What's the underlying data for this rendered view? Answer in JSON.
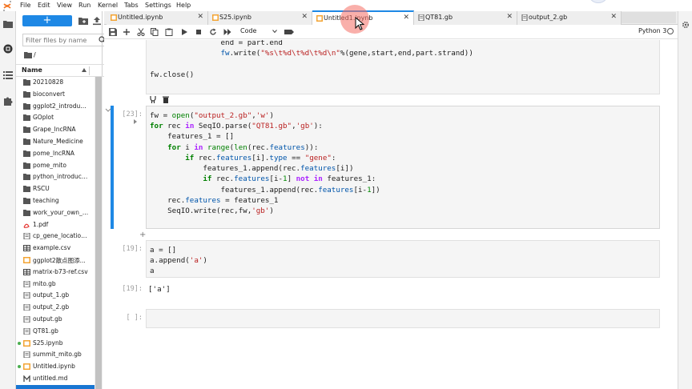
{
  "menubar": {
    "items": [
      "File",
      "Edit",
      "View",
      "Run",
      "Kernel",
      "Tabs",
      "Settings",
      "Help"
    ]
  },
  "filebrowser": {
    "new_label": "+",
    "search_placeholder": "Filter files by name",
    "breadcrumb": "/",
    "column_name": "Name",
    "files": [
      {
        "name": "20210828",
        "type": "folder",
        "running": false
      },
      {
        "name": "bioconvert",
        "type": "folder",
        "running": false
      },
      {
        "name": "ggplot2_introduct...",
        "type": "folder",
        "running": false
      },
      {
        "name": "GOplot",
        "type": "folder",
        "running": false
      },
      {
        "name": "Grape_lncRNA",
        "type": "folder",
        "running": false
      },
      {
        "name": "Nature_Medicine",
        "type": "folder",
        "running": false
      },
      {
        "name": "pome_lncRNA",
        "type": "folder",
        "running": false
      },
      {
        "name": "pome_mito",
        "type": "folder",
        "running": false
      },
      {
        "name": "python_introducti...",
        "type": "folder",
        "running": false
      },
      {
        "name": "RSCU",
        "type": "folder",
        "running": false
      },
      {
        "name": "teaching",
        "type": "folder",
        "running": false
      },
      {
        "name": "work_your_own_w...",
        "type": "folder",
        "running": false
      },
      {
        "name": "1.pdf",
        "type": "pdf",
        "running": false
      },
      {
        "name": "cp_gene_location....",
        "type": "file",
        "running": false
      },
      {
        "name": "example.csv",
        "type": "table",
        "running": false
      },
      {
        "name": "ggplot2散点图添...",
        "type": "notebook",
        "running": false
      },
      {
        "name": "matrix-b73-ref.csv",
        "type": "table",
        "running": false
      },
      {
        "name": "mito.gb",
        "type": "file",
        "running": false
      },
      {
        "name": "output_1.gb",
        "type": "file",
        "running": false
      },
      {
        "name": "output_2.gb",
        "type": "file",
        "running": false
      },
      {
        "name": "output.gb",
        "type": "file",
        "running": false
      },
      {
        "name": "QT81.gb",
        "type": "file",
        "running": false
      },
      {
        "name": "S25.ipynb",
        "type": "notebook",
        "running": true
      },
      {
        "name": "summit_mito.gb",
        "type": "file",
        "running": false
      },
      {
        "name": "Untitled.ipynb",
        "type": "notebook",
        "running": true
      },
      {
        "name": "untitled.md",
        "type": "markdown",
        "running": false
      }
    ]
  },
  "tabs": [
    {
      "label": "Untitled.ipynb",
      "active": false
    },
    {
      "label": "S25.ipynb",
      "active": false
    },
    {
      "label": "Untitled1.ipynb",
      "active": true
    },
    {
      "label": "QT81.gb",
      "active": false
    },
    {
      "label": "output_2.gb",
      "active": false
    }
  ],
  "toolbar": {
    "cell_type": "Code",
    "kernel_name": "Python 3"
  },
  "cells": {
    "cell0": {
      "lines": [
        "                end = part.end",
        "                fw.write(\"%s\\t%d\\t%d\\t%d\\n\"%(gene,start,end,part.strand))",
        "",
        "fw.close()"
      ]
    },
    "cell1": {
      "prompt": "[23]:",
      "lines": [
        "fw = open(\"output_2.gb\",'w')",
        "for rec in SeqIO.parse(\"QT81.gb\",'gb'):",
        "    features_1 = []",
        "    for i in range(len(rec.features)):",
        "        if rec.features[i].type == \"gene\":",
        "            features_1.append(rec.features[i])",
        "            if rec.features[i-1] not in features_1:",
        "                features_1.append(rec.features[i-1])",
        "    rec.features = features_1",
        "    SeqIO.write(rec,fw,'gb')"
      ]
    },
    "cell2": {
      "prompt": "[19]:",
      "lines": [
        "a = []",
        "a.append('a')",
        "a"
      ],
      "out_prompt": "[19]:",
      "output": "['a']"
    },
    "cell3": {
      "prompt": "[ ]:"
    }
  },
  "colors": {
    "accent": "#1e88e5",
    "keyword": "#008000",
    "string": "#ba2121",
    "operator": "#aa22ff",
    "selection": "#1976d2",
    "cursor_highlight": "#f46e64"
  }
}
